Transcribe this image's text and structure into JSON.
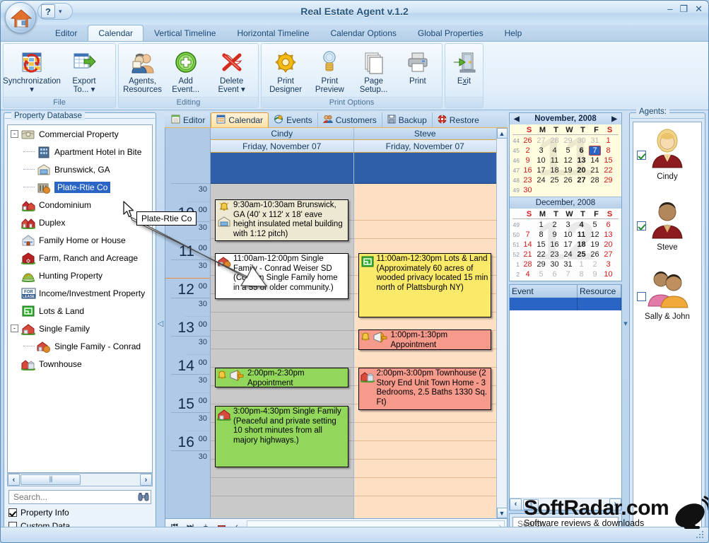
{
  "window": {
    "title": "Real Estate Agent v.1.2",
    "minimize": "–",
    "maximize": "❐",
    "close": "✕",
    "quick_access": {
      "help_label": "?",
      "dropdown": "▾"
    }
  },
  "ribbon": {
    "tabs": [
      {
        "label": "Editor",
        "active": false
      },
      {
        "label": "Calendar",
        "active": true
      },
      {
        "label": "Vertical Timeline",
        "active": false
      },
      {
        "label": "Horizontal Timeline",
        "active": false
      },
      {
        "label": "Calendar Options",
        "active": false
      },
      {
        "label": "Global Properties",
        "active": false
      },
      {
        "label": "Help",
        "active": false
      }
    ],
    "groups": [
      {
        "label": "File",
        "items": [
          {
            "label": "Synchronization",
            "sublabel": "▾",
            "icon": "synchronization-icon"
          },
          {
            "label": "Export",
            "label2": "To... ▾",
            "icon": "export-icon"
          }
        ]
      },
      {
        "label": "Editing",
        "items": [
          {
            "label": "Agents,",
            "label2": "Resources",
            "icon": "agents-resources-icon"
          },
          {
            "label": "Add",
            "label2": "Event...",
            "icon": "add-event-icon"
          },
          {
            "label": "Delete",
            "label2": "Event ▾",
            "icon": "delete-event-icon"
          }
        ]
      },
      {
        "label": "Print Options",
        "items": [
          {
            "label": "Print",
            "label2": "Designer",
            "icon": "print-designer-icon"
          },
          {
            "label": "Print",
            "label2": "Preview",
            "icon": "print-preview-icon"
          },
          {
            "label": "Page",
            "label2": "Setup...",
            "icon": "page-setup-icon"
          },
          {
            "label": "Print",
            "label2": "",
            "icon": "print-icon"
          }
        ]
      },
      {
        "label": "",
        "items": [
          {
            "label": "Exit",
            "label2": "",
            "icon": "exit-icon",
            "accesskey": "x"
          }
        ]
      }
    ]
  },
  "property_database": {
    "legend": "Property Database",
    "tree": [
      {
        "label": "Commercial Property",
        "level": 0,
        "expander": "-",
        "icon": "commercial-property-icon",
        "selected": false
      },
      {
        "label": "Apartment Hotel in Bite",
        "level": 1,
        "expander": "",
        "icon": "apartment-hotel-icon",
        "selected": false
      },
      {
        "label": "Brunswick, GA",
        "level": 1,
        "expander": "",
        "icon": "brunswick-icon",
        "selected": false
      },
      {
        "label": "Plate-Rtie Co",
        "level": 1,
        "expander": "",
        "icon": "plate-rtie-icon",
        "selected": true
      },
      {
        "label": "Condominium",
        "level": 0,
        "expander": "",
        "icon": "condominium-icon",
        "selected": false
      },
      {
        "label": "Duplex",
        "level": 0,
        "expander": "",
        "icon": "duplex-icon",
        "selected": false
      },
      {
        "label": "Family Home or House",
        "level": 0,
        "expander": "",
        "icon": "family-home-icon",
        "selected": false
      },
      {
        "label": "Farm, Ranch and Acreage",
        "level": 0,
        "expander": "",
        "icon": "farm-ranch-icon",
        "selected": false
      },
      {
        "label": "Hunting Property",
        "level": 0,
        "expander": "",
        "icon": "hunting-property-icon",
        "selected": false
      },
      {
        "label": "Income/Investment Property",
        "level": 0,
        "expander": "",
        "icon": "for-lease-icon",
        "selected": false
      },
      {
        "label": "Lots & Land",
        "level": 0,
        "expander": "",
        "icon": "lots-land-icon",
        "selected": false
      },
      {
        "label": "Single Family",
        "level": 0,
        "expander": "-",
        "icon": "single-family-icon",
        "selected": false
      },
      {
        "label": "Single Family - Conrad",
        "level": 1,
        "expander": "",
        "icon": "single-family-conrad-icon",
        "selected": false
      },
      {
        "label": "Townhouse",
        "level": 0,
        "expander": "",
        "icon": "townhouse-icon",
        "selected": false
      }
    ],
    "search": {
      "value": "",
      "placeholder": "Search..."
    },
    "checkboxes": [
      {
        "label": "Property Info",
        "checked": true
      },
      {
        "label": "Custom Data",
        "checked": false
      }
    ],
    "scroll_left": "‹",
    "scroll_right": "›"
  },
  "tooltip": {
    "text": "Plate-Rtie Co"
  },
  "view_tabs": [
    {
      "label": "Editor",
      "icon": "editor-icon",
      "active": false
    },
    {
      "label": "Calendar",
      "icon": "calendar-icon",
      "active": true
    },
    {
      "label": "Events",
      "icon": "events-icon",
      "active": false
    },
    {
      "label": "Customers",
      "icon": "customers-icon",
      "active": false
    },
    {
      "label": "Backup",
      "icon": "backup-icon",
      "active": false
    },
    {
      "label": "Restore",
      "icon": "restore-icon",
      "active": false
    }
  ],
  "calendar": {
    "gutter": [
      {
        "hour": "",
        "min": "30",
        "type": "half"
      },
      {
        "hour": "10",
        "min": "00",
        "type": "hour"
      },
      {
        "hour": "",
        "min": "30",
        "type": "half"
      },
      {
        "hour": "11",
        "min": "00",
        "type": "hour"
      },
      {
        "hour": "",
        "min": "30",
        "type": "half"
      },
      {
        "hour": "12",
        "min": "00",
        "type": "hour"
      },
      {
        "hour": "",
        "min": "30",
        "type": "half"
      },
      {
        "hour": "13",
        "min": "00",
        "type": "hour"
      },
      {
        "hour": "",
        "min": "30",
        "type": "half"
      },
      {
        "hour": "14",
        "min": "00",
        "type": "hour"
      },
      {
        "hour": "",
        "min": "30",
        "type": "half"
      },
      {
        "hour": "15",
        "min": "00",
        "type": "hour"
      },
      {
        "hour": "",
        "min": "30",
        "type": "half"
      },
      {
        "hour": "16",
        "min": "00",
        "type": "hour"
      },
      {
        "hour": "",
        "min": "30",
        "type": "half"
      }
    ],
    "columns": [
      {
        "agent": "Cindy",
        "date": "Friday, November 07",
        "events": [
          {
            "time": "9:30am-10:30am",
            "text": "9:30am-10:30am Brunswick, GA (40' x 112' x 18' eave height insulated metal building with 1:12 pitch)",
            "color": "beige",
            "icons": [
              "alarm-bell-icon",
              "brunswick-icon"
            ]
          },
          {
            "time": "11:00am-12:00pm",
            "text": "11:00am-12:00pm Single Family - Conrad Weiser SD (Custom Single Family home in a 55 or older community.)",
            "color": "white",
            "icons": [
              "single-family-conrad-icon"
            ]
          },
          {
            "time": "2:00pm-2:30pm",
            "text": "2:00pm-2:30pm Appointment",
            "color": "green",
            "icons": [
              "alarm-bell-icon",
              "megaphone-icon"
            ]
          },
          {
            "time": "3:00pm-4:30pm",
            "text": "3:00pm-4:30pm Single Family (Peaceful and private setting 10 short minutes from all majory highways.)",
            "color": "green",
            "icons": [
              "single-family-icon"
            ]
          }
        ]
      },
      {
        "agent": "Steve",
        "date": "Friday, November 07",
        "events": [
          {
            "time": "11:00am-12:30pm",
            "text": "11:00am-12:30pm Lots & Land (Approximately 60 acres of wooded privacy located 15 min north of Plattsburgh NY)",
            "color": "yellow",
            "icons": [
              "lots-land-icon"
            ]
          },
          {
            "time": "1:00pm-1:30pm",
            "text": "1:00pm-1:30pm Appointment",
            "color": "salmon",
            "icons": [
              "alarm-bell-icon",
              "megaphone-icon"
            ]
          },
          {
            "time": "2:00pm-3:00pm",
            "text": "2:00pm-3:00pm Townhouse (2 Story End Unit Town Home - 3 Bedrooms, 2.5 Baths 1330 Sq. Ft)",
            "color": "salmon",
            "icons": [
              "townhouse-icon"
            ]
          }
        ]
      }
    ],
    "bottom_nav": {
      "first": "⏮",
      "last": "⏭",
      "add": "+",
      "remove": "–",
      "scroll_left": "‹",
      "scroll_right": "›"
    },
    "vscroll": {
      "up": "▲",
      "down": "▼"
    }
  },
  "minicalendars": {
    "prev": "◀",
    "next": "▶",
    "months": [
      {
        "title": "November, 2008",
        "ghost": "11",
        "dow": [
          "S",
          "M",
          "T",
          "W",
          "T",
          "F",
          "S"
        ],
        "weeks": [
          {
            "wk": "44",
            "days": [
              {
                "d": "26",
                "cls": "sun"
              },
              {
                "d": "27",
                "cls": "dim"
              },
              {
                "d": "28",
                "cls": "dim"
              },
              {
                "d": "29",
                "cls": "dim"
              },
              {
                "d": "30",
                "cls": "dim"
              },
              {
                "d": "31",
                "cls": "dim"
              },
              {
                "d": "1",
                "cls": "sat"
              }
            ]
          },
          {
            "wk": "45",
            "days": [
              {
                "d": "2",
                "cls": "sun"
              },
              {
                "d": "3",
                "cls": ""
              },
              {
                "d": "4",
                "cls": ""
              },
              {
                "d": "5",
                "cls": ""
              },
              {
                "d": "6",
                "cls": "bold"
              },
              {
                "d": "7",
                "cls": "sel"
              },
              {
                "d": "8",
                "cls": "sat"
              }
            ]
          },
          {
            "wk": "46",
            "days": [
              {
                "d": "9",
                "cls": "sun"
              },
              {
                "d": "10",
                "cls": ""
              },
              {
                "d": "11",
                "cls": ""
              },
              {
                "d": "12",
                "cls": ""
              },
              {
                "d": "13",
                "cls": "bold"
              },
              {
                "d": "14",
                "cls": ""
              },
              {
                "d": "15",
                "cls": "sat"
              }
            ]
          },
          {
            "wk": "47",
            "days": [
              {
                "d": "16",
                "cls": "sun"
              },
              {
                "d": "17",
                "cls": ""
              },
              {
                "d": "18",
                "cls": ""
              },
              {
                "d": "19",
                "cls": ""
              },
              {
                "d": "20",
                "cls": "bold"
              },
              {
                "d": "21",
                "cls": ""
              },
              {
                "d": "22",
                "cls": "sat"
              }
            ]
          },
          {
            "wk": "48",
            "days": [
              {
                "d": "23",
                "cls": "sun"
              },
              {
                "d": "24",
                "cls": ""
              },
              {
                "d": "25",
                "cls": ""
              },
              {
                "d": "26",
                "cls": ""
              },
              {
                "d": "27",
                "cls": "bold"
              },
              {
                "d": "28",
                "cls": ""
              },
              {
                "d": "29",
                "cls": "sat"
              }
            ]
          },
          {
            "wk": "49",
            "days": [
              {
                "d": "30",
                "cls": "sun"
              },
              {
                "d": "",
                "cls": ""
              },
              {
                "d": "",
                "cls": ""
              },
              {
                "d": "",
                "cls": ""
              },
              {
                "d": "",
                "cls": ""
              },
              {
                "d": "",
                "cls": ""
              },
              {
                "d": "",
                "cls": ""
              }
            ]
          }
        ]
      },
      {
        "title": "December, 2008",
        "ghost": "12",
        "dow": [
          "S",
          "M",
          "T",
          "W",
          "T",
          "F",
          "S"
        ],
        "weeks": [
          {
            "wk": "49",
            "days": [
              {
                "d": "",
                "cls": ""
              },
              {
                "d": "1",
                "cls": ""
              },
              {
                "d": "2",
                "cls": ""
              },
              {
                "d": "3",
                "cls": ""
              },
              {
                "d": "4",
                "cls": "bold"
              },
              {
                "d": "5",
                "cls": ""
              },
              {
                "d": "6",
                "cls": "sat"
              }
            ]
          },
          {
            "wk": "50",
            "days": [
              {
                "d": "7",
                "cls": "sun"
              },
              {
                "d": "8",
                "cls": ""
              },
              {
                "d": "9",
                "cls": ""
              },
              {
                "d": "10",
                "cls": ""
              },
              {
                "d": "11",
                "cls": "bold"
              },
              {
                "d": "12",
                "cls": ""
              },
              {
                "d": "13",
                "cls": "sat"
              }
            ]
          },
          {
            "wk": "51",
            "days": [
              {
                "d": "14",
                "cls": "sun"
              },
              {
                "d": "15",
                "cls": ""
              },
              {
                "d": "16",
                "cls": ""
              },
              {
                "d": "17",
                "cls": ""
              },
              {
                "d": "18",
                "cls": "bold"
              },
              {
                "d": "19",
                "cls": ""
              },
              {
                "d": "20",
                "cls": "sat"
              }
            ]
          },
          {
            "wk": "52",
            "days": [
              {
                "d": "21",
                "cls": "sun"
              },
              {
                "d": "22",
                "cls": ""
              },
              {
                "d": "23",
                "cls": ""
              },
              {
                "d": "24",
                "cls": ""
              },
              {
                "d": "25",
                "cls": "bold"
              },
              {
                "d": "26",
                "cls": ""
              },
              {
                "d": "27",
                "cls": "sat"
              }
            ]
          },
          {
            "wk": "1",
            "days": [
              {
                "d": "28",
                "cls": "sun"
              },
              {
                "d": "29",
                "cls": ""
              },
              {
                "d": "30",
                "cls": ""
              },
              {
                "d": "31",
                "cls": ""
              },
              {
                "d": "1",
                "cls": "dim"
              },
              {
                "d": "2",
                "cls": "dim"
              },
              {
                "d": "3",
                "cls": "sat"
              }
            ]
          },
          {
            "wk": "2",
            "days": [
              {
                "d": "4",
                "cls": "sun"
              },
              {
                "d": "5",
                "cls": "dim"
              },
              {
                "d": "6",
                "cls": "dim"
              },
              {
                "d": "7",
                "cls": "dim"
              },
              {
                "d": "8",
                "cls": "dim"
              },
              {
                "d": "9",
                "cls": "dim"
              },
              {
                "d": "10",
                "cls": "sat"
              }
            ]
          }
        ]
      }
    ]
  },
  "event_grid": {
    "columns": [
      "Event",
      "Resource"
    ],
    "rows": [],
    "scroll_left": "‹",
    "scroll_right": "›"
  },
  "search_bottom": {
    "value": "",
    "placeholder": "Search..."
  },
  "agents_panel": {
    "legend": "Agents:",
    "agents": [
      {
        "name": "Cindy",
        "checked": true,
        "avatar": "female-agent-avatar"
      },
      {
        "name": "Steve",
        "checked": true,
        "avatar": "male-agent-avatar"
      },
      {
        "name": "Sally & John",
        "checked": false,
        "avatar": "couple-agent-avatar"
      }
    ]
  },
  "watermark": {
    "line1": "SoftRadar.com",
    "line2": "Software reviews & downloads"
  },
  "colors": {
    "accent_blue": "#2a64c4",
    "ribbon_bg": "#e2eefa",
    "selected_tab": "#ffe1a8",
    "cindy_bg": "#c9c9c9",
    "steve_bg": "#fde0c4",
    "allday_bar": "#2f5fa8"
  }
}
